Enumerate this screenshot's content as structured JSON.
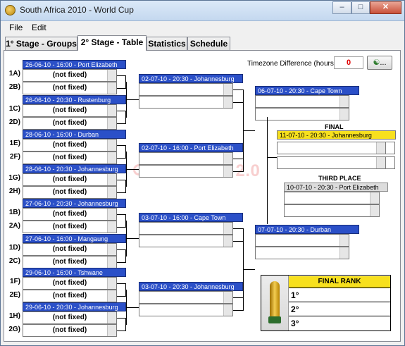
{
  "window": {
    "title": "South Africa 2010 - World Cup"
  },
  "menu": [
    "File",
    "Edit"
  ],
  "tabs": [
    "1° Stage - Groups",
    "2° Stage - Table",
    "Statistics",
    "Schedule"
  ],
  "timezone": {
    "label": "Timezone Difference (hours):",
    "value": "0",
    "button": "..."
  },
  "r16": [
    {
      "header": "26-06-10 - 16:00 - Port Elizabeth",
      "team1_code": "1A)",
      "team1": "(not fixed)",
      "team2_code": "2B)",
      "team2": "(not fixed)"
    },
    {
      "header": "26-06-10 - 20:30 - Rustenburg",
      "team1_code": "1C)",
      "team1": "(not fixed)",
      "team2_code": "2D)",
      "team2": "(not fixed)"
    },
    {
      "header": "28-06-10 - 16:00 - Durban",
      "team1_code": "1E)",
      "team1": "(not fixed)",
      "team2_code": "2F)",
      "team2": "(not fixed)"
    },
    {
      "header": "28-06-10 - 20:30 - Johannesburg",
      "team1_code": "1G)",
      "team1": "(not fixed)",
      "team2_code": "2H)",
      "team2": "(not fixed)"
    },
    {
      "header": "27-06-10 - 20:30 - Johannesburg",
      "team1_code": "1B)",
      "team1": "(not fixed)",
      "team2_code": "2A)",
      "team2": "(not fixed)"
    },
    {
      "header": "27-06-10 - 16:00 - Mangaung",
      "team1_code": "1D)",
      "team1": "(not fixed)",
      "team2_code": "2C)",
      "team2": "(not fixed)"
    },
    {
      "header": "29-06-10 - 16:00 - Tshwane",
      "team1_code": "1F)",
      "team1": "(not fixed)",
      "team2_code": "2E)",
      "team2": "(not fixed)"
    },
    {
      "header": "29-06-10 - 20:30 - Johannesburg",
      "team1_code": "1H)",
      "team1": "(not fixed)",
      "team2_code": "2G)",
      "team2": "(not fixed)"
    }
  ],
  "qf": [
    {
      "header": "02-07-10 - 20:30 - Johannesburg"
    },
    {
      "header": "02-07-10 - 16:00 - Port Elizabeth"
    },
    {
      "header": "03-07-10 - 16:00 - Cape Town"
    },
    {
      "header": "03-07-10 - 20:30 - Johannesburg"
    }
  ],
  "sf": [
    {
      "header": "06-07-10 - 20:30 - Cape Town"
    },
    {
      "header": "07-07-10 - 20:30 - Durban"
    }
  ],
  "final": {
    "label": "FINAL",
    "header": "11-07-10 - 20:30 - Johannesburg"
  },
  "third": {
    "label": "THIRD PLACE",
    "header": "10-07-10 - 20:30 - Port Elizabeth"
  },
  "rank": {
    "title": "FINAL RANK",
    "places": [
      "1°",
      "2°",
      "3°"
    ]
  },
  "watermark": "Life Rocks 2.0",
  "colors": {
    "match_header": "#2b50c8",
    "final_header": "#f7e01e",
    "timezone_value": "#e00000"
  }
}
